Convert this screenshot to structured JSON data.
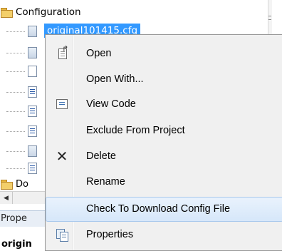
{
  "tree": {
    "root_label": "Configuration",
    "selected_item": "original101415.cfg",
    "folder2_label": "Do",
    "rows": [
      {
        "icon": "cfg-file-icon"
      },
      {
        "icon": "cfg-file-icon"
      },
      {
        "icon": "blank-file-icon"
      },
      {
        "icon": "code-file-icon"
      },
      {
        "icon": "code-file-icon"
      },
      {
        "icon": "code-file-icon"
      },
      {
        "icon": "cfg-file-icon"
      },
      {
        "icon": "code-file-icon"
      }
    ]
  },
  "properties_panel": {
    "title": "Prope",
    "name": "origin"
  },
  "context_menu": {
    "items": [
      {
        "label": "Open",
        "icon": "open-icon"
      },
      {
        "label": "Open With...",
        "icon": ""
      },
      {
        "label": "View Code",
        "icon": "view-code-icon"
      },
      {
        "label": "Exclude From Project",
        "icon": ""
      },
      {
        "label": "Delete",
        "icon": "delete-icon"
      },
      {
        "label": "Rename",
        "icon": ""
      },
      {
        "label": "Check To Download Config File",
        "icon": "",
        "highlighted": true
      },
      {
        "label": "Properties",
        "icon": "properties-icon"
      }
    ]
  },
  "colors": {
    "selection": "#3399ff",
    "menu_background": "#f0f0f0",
    "highlight_border": "#a8c8ec"
  }
}
